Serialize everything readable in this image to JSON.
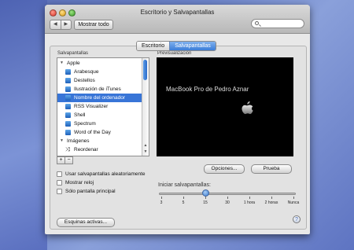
{
  "window": {
    "title": "Escritorio y Salvapantallas",
    "show_all_label": "Mostrar todo",
    "nav_back": "◀",
    "nav_forward": "▶"
  },
  "tabs": [
    {
      "label": "Escritorio",
      "active": false
    },
    {
      "label": "Salvapantallas",
      "active": true
    }
  ],
  "saver_list": {
    "header": "Salvapantallas",
    "items": [
      {
        "label": "Apple",
        "kind": "group"
      },
      {
        "label": "Arabesque",
        "kind": "item"
      },
      {
        "label": "Destellos",
        "kind": "item"
      },
      {
        "label": "Ilustración de iTunes",
        "kind": "item"
      },
      {
        "label": "Nombre del ordenador",
        "kind": "item",
        "selected": true
      },
      {
        "label": "RSS Visualizer",
        "kind": "item"
      },
      {
        "label": "Shell",
        "kind": "item"
      },
      {
        "label": "Spectrum",
        "kind": "item"
      },
      {
        "label": "Word of the Day",
        "kind": "item"
      },
      {
        "label": "Imágenes",
        "kind": "group"
      },
      {
        "label": "Reordenar",
        "kind": "item"
      }
    ],
    "add_label": "+",
    "remove_label": "−"
  },
  "preview": {
    "header": "Previsualización",
    "computer_name": "MacBook Pro de Pedro Aznar",
    "icon": "apple-logo-icon"
  },
  "buttons": {
    "options": "Opciones...",
    "test": "Prueba",
    "hot_corners": "Esquinas activas...",
    "help": "?"
  },
  "checkboxes": [
    {
      "label": "Usar salvapantallas aleatoriamente",
      "checked": false
    },
    {
      "label": "Mostrar reloj",
      "checked": false
    },
    {
      "label": "Sólo pantalla principal",
      "checked": false
    }
  ],
  "start_slider": {
    "label": "Iniciar salvapantallas:",
    "ticks": [
      "3",
      "5",
      "15",
      "30",
      "1 hora",
      "2 horas",
      "Nunca"
    ],
    "selected": "15"
  },
  "colors": {
    "selection": "#3875d7",
    "accent": "#3b7dd8"
  }
}
